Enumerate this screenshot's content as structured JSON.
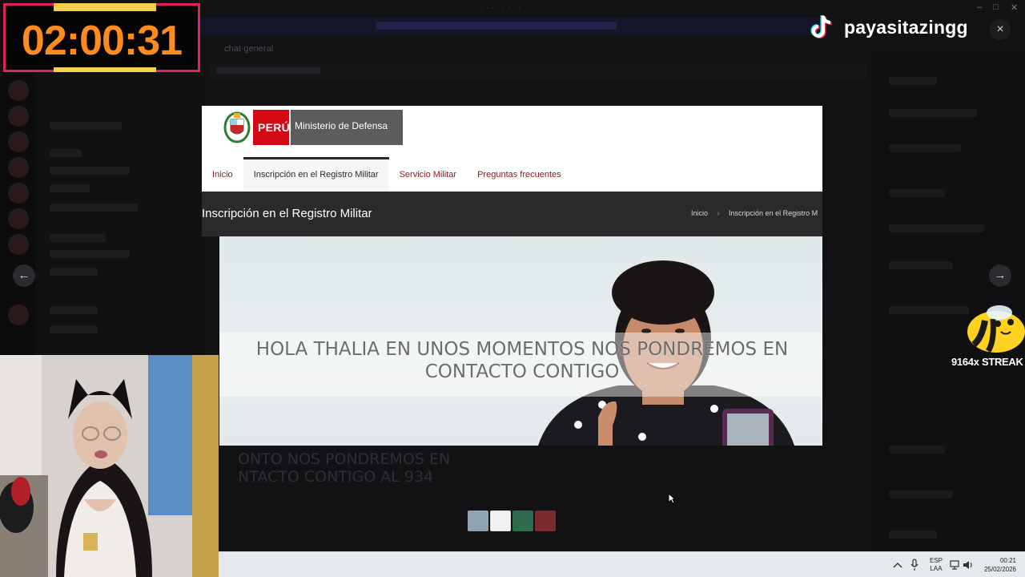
{
  "timer": {
    "text": "02:00:31",
    "color": "#ff8a1e",
    "frame_color": "#e0215e"
  },
  "tiktok": {
    "username": "payasitazingg",
    "icon": "tiktok-icon"
  },
  "streak": {
    "text": "9164x STREAK"
  },
  "background_app": {
    "channel": "chat-general"
  },
  "website": {
    "logo": {
      "country": "PERÚ",
      "ministry": "Ministerio de Defensa",
      "icon": "coat-of-arms-icon"
    },
    "nav": [
      {
        "label": "Inicio"
      },
      {
        "label": "Inscripción en el Registro Militar"
      },
      {
        "label": "Servicio Militar"
      },
      {
        "label": "Preguntas frecuentes"
      }
    ],
    "active_nav": "Inscripción en el Registro Militar",
    "page_title": "Inscripción en el Registro Militar",
    "breadcrumb": [
      "Inicio",
      "Inscripción en el Registro M"
    ],
    "hero_message": "HOLA THALIA EN UNOS MOMENTOS NOS PONDREMOS EN CONTACTO CONTIGO",
    "brand_color": "#d30a16"
  },
  "behind_text": {
    "line1": "ONTO NOS PONDREMOS EN",
    "line2": "NTACTO CONTIGO AL 934"
  },
  "controls": {
    "prev": "←",
    "next": "→",
    "close": "×"
  },
  "taskbar": {
    "lang_top": "ESP",
    "lang_bottom": "LAA",
    "time": "00:21",
    "date": "25/02/2026"
  }
}
